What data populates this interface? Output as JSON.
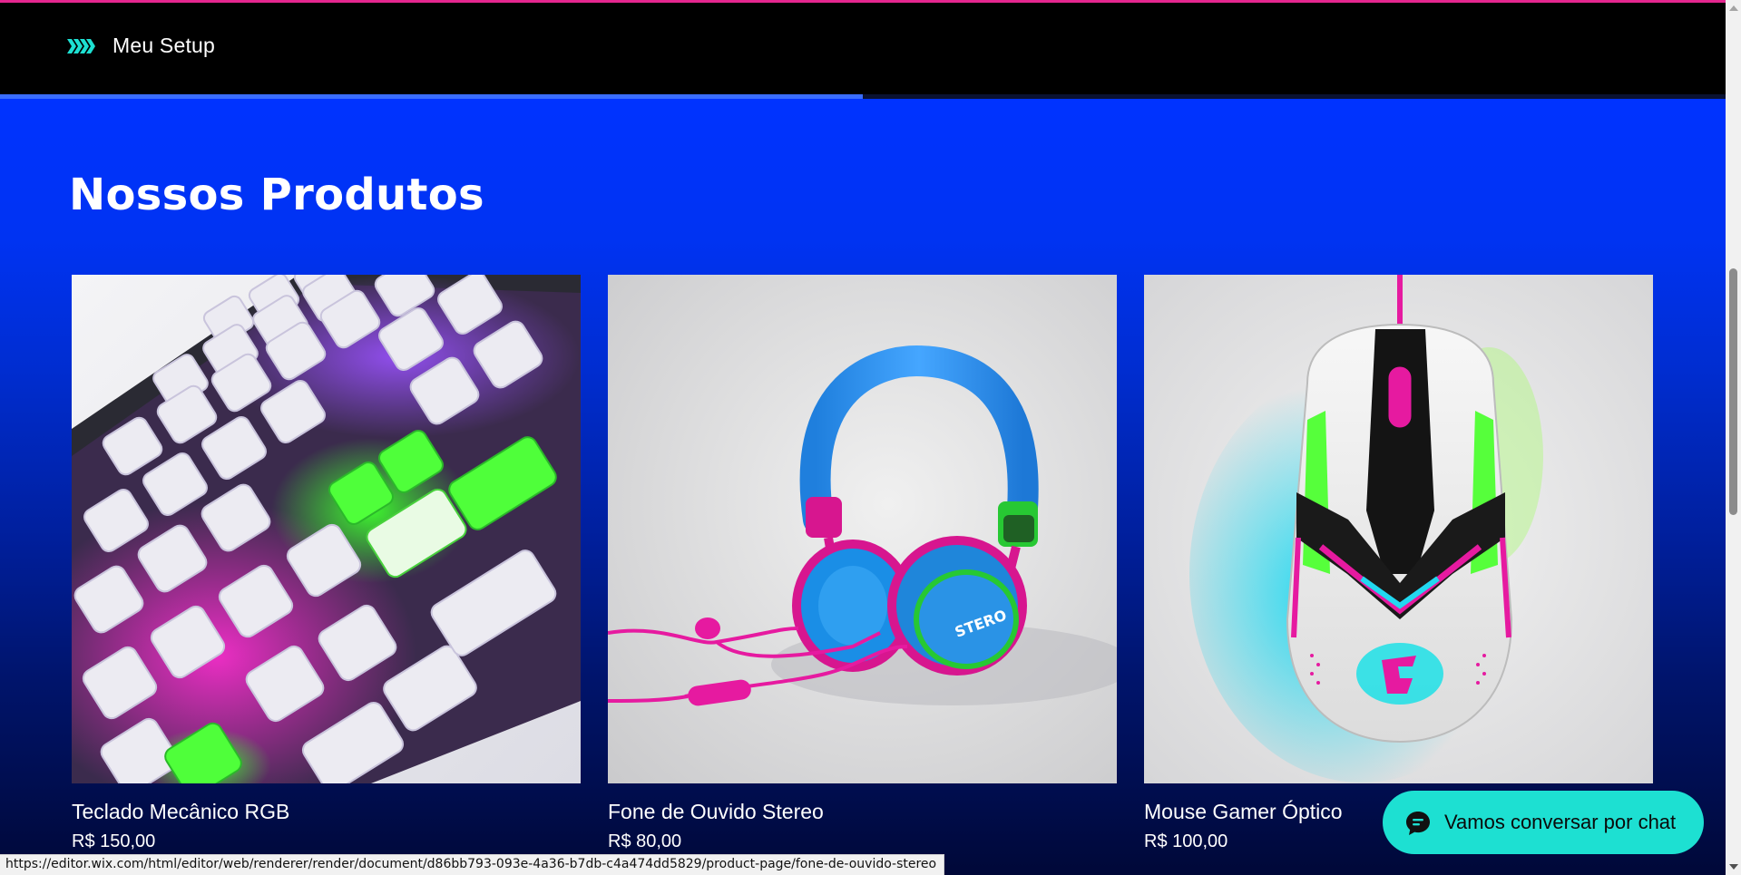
{
  "header": {
    "site_name": "Meu Setup",
    "logo_icon": "chevrons-logo-icon",
    "progress_fraction": 0.5
  },
  "section": {
    "title": "Nossos Produtos"
  },
  "products": [
    {
      "name": "Teclado Mecânico RGB",
      "price": "R$ 150,00",
      "image": "keyboard-image"
    },
    {
      "name": "Fone de Ouvido Stereo",
      "price": "R$ 80,00",
      "image": "headphones-image"
    },
    {
      "name": "Mouse Gamer Óptico",
      "price": "R$ 100,00",
      "image": "mouse-image"
    }
  ],
  "chat": {
    "label": "Vamos conversar por chat",
    "icon": "chat-bubble-icon"
  },
  "status_bar": {
    "url": "https://editor.wix.com/html/editor/web/renderer/render/document/d86bb793-093e-4a36-b7db-c4a474dd5829/product-page/fone-de-ouvido-stereo"
  },
  "colors": {
    "accent_cyan": "#1de0d2",
    "brand_blue": "#0033ff",
    "top_line": "#e4268f"
  }
}
